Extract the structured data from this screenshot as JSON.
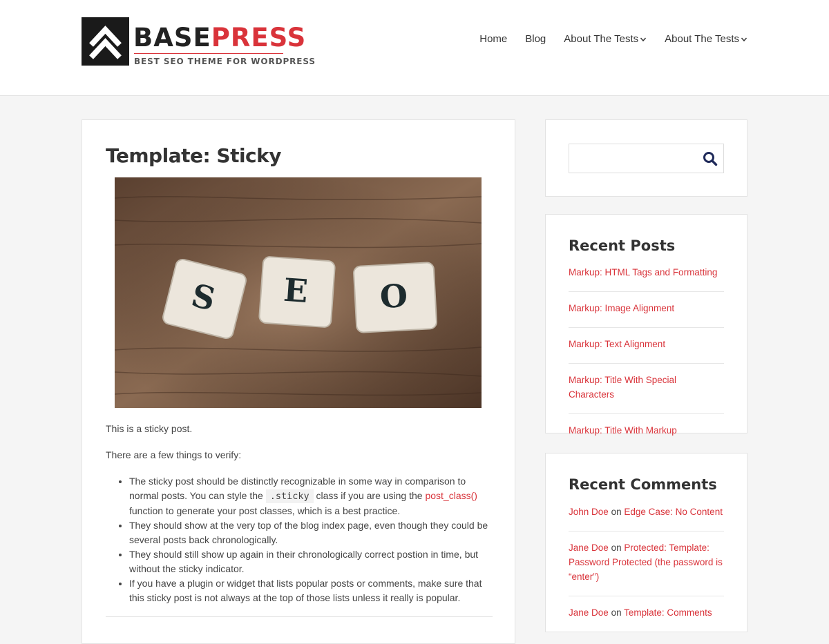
{
  "site": {
    "logo_word_1": "BASE",
    "logo_word_2": "PRESS",
    "logo_tagline": "BEST SEO THEME FOR WORDPRESS"
  },
  "nav": {
    "items": [
      {
        "label": "Home",
        "has_dropdown": false
      },
      {
        "label": "Blog",
        "has_dropdown": false
      },
      {
        "label": "About The Tests",
        "has_dropdown": true
      },
      {
        "label": "About The Tests",
        "has_dropdown": true
      }
    ]
  },
  "post": {
    "title": "Template: Sticky",
    "image_tiles": [
      "S",
      "E",
      "O"
    ],
    "intro": "This is a sticky post.",
    "lead": "There are a few things to verify:",
    "bullet1_a": "The sticky post should be distinctly recognizable in some way in comparison to normal posts. You can style the ",
    "bullet1_code": ".sticky",
    "bullet1_b": " class if you are using the ",
    "bullet1_link": "post_class()",
    "bullet1_c": " function to generate your post classes, which is a best practice.",
    "bullet2": "They should show at the very top of the blog index page, even though they could be several posts back chronologically.",
    "bullet3": "They should still show up again in their chronologically correct postion in time, but without the sticky indicator.",
    "bullet4": "If you have a plugin or widget that lists popular posts or comments, make sure that this sticky post is not always at the top of those lists unless it really is popular."
  },
  "search": {
    "placeholder": "",
    "icon": "search-icon"
  },
  "recent_posts": {
    "title": "Recent Posts",
    "items": [
      "Markup: HTML Tags and Formatting",
      "Markup: Image Alignment",
      "Markup: Text Alignment",
      "Markup: Title With Special Characters",
      "Markup: Title With Markup"
    ]
  },
  "recent_comments": {
    "title": "Recent Comments",
    "on_word": "on",
    "items": [
      {
        "author": "John Doe",
        "post": "Edge Case: No Content"
      },
      {
        "author": "Jane Doe",
        "post": "Protected: Template: Password Protected (the password is “enter”)"
      },
      {
        "author": "Jane Doe",
        "post": "Template: Comments"
      }
    ]
  },
  "colors": {
    "accent": "#d9333a",
    "text": "#444444",
    "page_bg": "#f5f5f5"
  }
}
